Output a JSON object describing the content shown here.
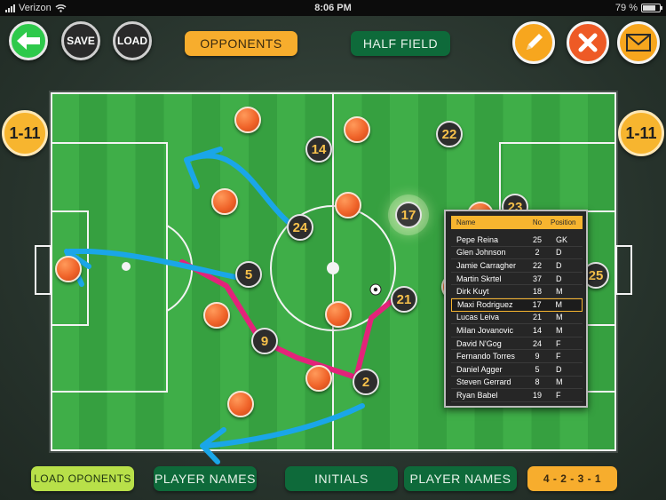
{
  "status_bar": {
    "carrier": "Verizon",
    "time": "8:06 PM",
    "battery": "79 %",
    "battery_level": 0.79
  },
  "toolbar": {
    "save_label": "SAVE",
    "load_label": "LOAD",
    "opponents_label": "OPPONENTS",
    "half_field_label": "HALF FIELD"
  },
  "side": {
    "left_label": "1-11",
    "right_label": "1-11"
  },
  "bottom_bar": {
    "load_opponents_label": "LOAD OPONENTS",
    "player_names_left_label": "PLAYER NAMES",
    "initials_label": "INITIALS",
    "player_names_right_label": "PLAYER NAMES",
    "formation_label": "4 - 2 - 3 - 1"
  },
  "markers": [
    "14",
    "22",
    "24",
    "5",
    "9",
    "21",
    "2",
    "17",
    "23",
    "25"
  ],
  "roster": {
    "headers": {
      "name": "Name",
      "no": "No",
      "position": "Position"
    },
    "rows": [
      {
        "name": "Pepe Reina",
        "no": "25",
        "pos": "GK"
      },
      {
        "name": "Glen Johnson",
        "no": "2",
        "pos": "D"
      },
      {
        "name": "Jamie Carragher",
        "no": "22",
        "pos": "D"
      },
      {
        "name": "Martin Skrtel",
        "no": "37",
        "pos": "D"
      },
      {
        "name": "Dirk Kuyt",
        "no": "18",
        "pos": "M"
      },
      {
        "name": "Maxi Rodriguez",
        "no": "17",
        "pos": "M"
      },
      {
        "name": "Lucas Leiva",
        "no": "21",
        "pos": "M"
      },
      {
        "name": "Milan Jovanovic",
        "no": "14",
        "pos": "M"
      },
      {
        "name": "David N'Gog",
        "no": "24",
        "pos": "F"
      },
      {
        "name": "Fernando Torres",
        "no": "9",
        "pos": "F"
      },
      {
        "name": "Daniel Agger",
        "no": "5",
        "pos": "D"
      },
      {
        "name": "Steven Gerrard",
        "no": "8",
        "pos": "M"
      },
      {
        "name": "Ryan Babel",
        "no": "19",
        "pos": "F"
      }
    ],
    "selected_index": 5
  },
  "colors": {
    "accent_orange": "#f7ad2d",
    "accent_green": "#0e6a3a",
    "arrow_blue": "#1aa6e8",
    "arrow_pink": "#e3237a"
  }
}
